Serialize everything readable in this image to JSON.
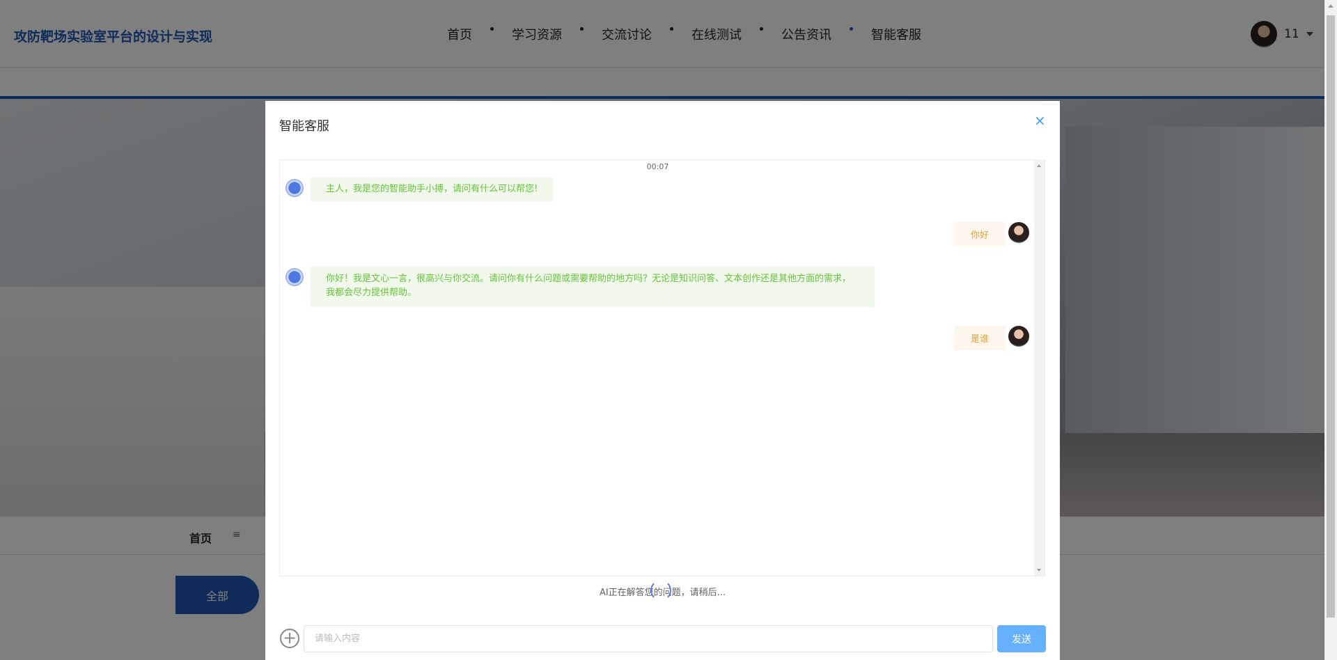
{
  "header": {
    "logo": "攻防靶场实验室平台的设计与实现",
    "nav": [
      "首页",
      "学习资源",
      "交流讨论",
      "在线测试",
      "公告资讯",
      "智能客服"
    ],
    "active_nav": "公告资讯",
    "username": "11"
  },
  "page": {
    "breadcrumb_home": "首页",
    "breadcrumb_sep": "≡",
    "tab_all": "全部"
  },
  "dialog": {
    "title": "智能客服",
    "close_icon": "×",
    "timestamp": "00:07",
    "messages": [
      {
        "role": "bot",
        "text": "主人，我是您的智能助手小搏，请问有什么可以帮您!"
      },
      {
        "role": "user",
        "text": "你好"
      },
      {
        "role": "bot",
        "text": "你好！我是文心一言，很高兴与你交流。请问你有什么问题或需要帮助的地方吗？无论是知识问答、文本创作还是其他方面的需求，我都会尽力提供帮助。"
      },
      {
        "role": "user",
        "text": "是谁"
      }
    ],
    "status": "AI正在解答您的问题，请稍后...",
    "input_placeholder": "请输入内容",
    "send_label": "发送"
  },
  "colors": {
    "brand": "#1e56b3",
    "bot_text": "#67c23a",
    "user_text": "#e6a23c",
    "send": "#66b1ff"
  }
}
